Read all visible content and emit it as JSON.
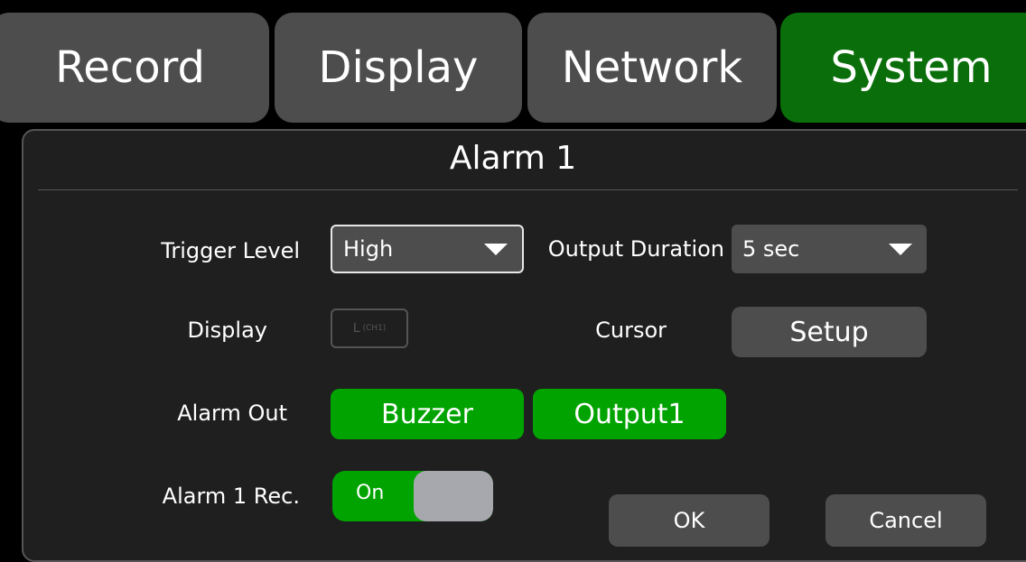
{
  "tabs": [
    {
      "label": "Record",
      "active": false
    },
    {
      "label": "Display",
      "active": false
    },
    {
      "label": "Network",
      "active": false
    },
    {
      "label": "System",
      "active": true
    }
  ],
  "panel": {
    "title": "Alarm 1"
  },
  "form": {
    "trigger_level": {
      "label": "Trigger Level",
      "value": "High"
    },
    "output_duration": {
      "label": "Output Duration",
      "value": "5 sec"
    },
    "display": {
      "label": "Display",
      "box_text": "L",
      "box_sub": "(CH1)"
    },
    "cursor": {
      "label": "Cursor",
      "button": "Setup"
    },
    "alarm_out": {
      "label": "Alarm Out",
      "buttons": [
        "Buzzer",
        "Output1"
      ]
    },
    "alarm_rec": {
      "label": "Alarm 1 Rec.",
      "toggle_text": "On",
      "toggle_state": "on"
    }
  },
  "actions": {
    "ok": "OK",
    "cancel": "Cancel"
  },
  "colors": {
    "active_tab": "#0a6e0a",
    "green_button": "#00a300",
    "gray_control": "#4d4d4d",
    "background": "#000000"
  }
}
